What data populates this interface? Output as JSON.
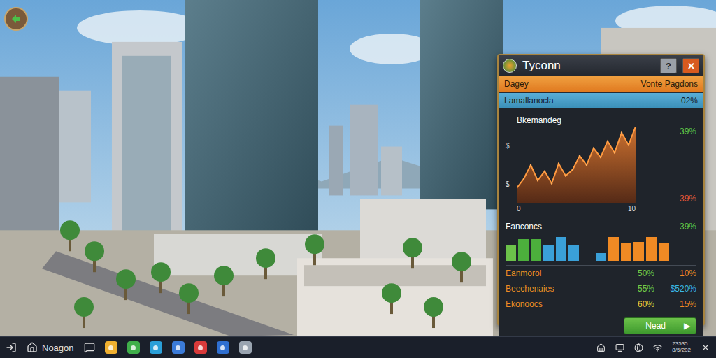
{
  "window": {
    "title": "Tyconn"
  },
  "title_buttons": [
    {
      "label": "?",
      "kind": "help"
    },
    {
      "label": "✕",
      "kind": "close"
    }
  ],
  "header": {
    "left": "Dagey",
    "right": "Vonte Pagdons"
  },
  "highlight_row": {
    "label": "Lamallanocla",
    "value": "02%"
  },
  "line_chart": {
    "title": "Bkemandeg",
    "y_ticks": [
      "$",
      "$"
    ],
    "x_ticks": [
      "0",
      "10"
    ],
    "y_max": 10,
    "values": [
      2,
      3.2,
      5,
      3,
      4.2,
      2.6,
      5.2,
      3.6,
      4.4,
      6.2,
      5,
      7.2,
      6,
      8.1,
      6.6,
      9.2,
      7.6,
      10
    ],
    "readings": [
      {
        "text": "39%",
        "color": "#5fd04a"
      },
      {
        "text": "39%",
        "color": "#e85a3a"
      }
    ]
  },
  "bar_chart": {
    "title": "Fanconcs",
    "value": "39%",
    "groups": [
      [
        {
          "value": 60,
          "color": "#6cc24a"
        },
        {
          "value": 85,
          "color": "#4caf3c"
        },
        {
          "value": 85,
          "color": "#4caf3c"
        },
        {
          "value": 60,
          "color": "#3aa0d8"
        },
        {
          "value": 95,
          "color": "#3aa0d8"
        },
        {
          "value": 60,
          "color": "#3aa0d8"
        }
      ],
      [
        {
          "value": 30,
          "color": "#3aa0d8"
        },
        {
          "value": 95,
          "color": "#f08a24"
        },
        {
          "value": 70,
          "color": "#f08a24"
        },
        {
          "value": 75,
          "color": "#f08a24"
        },
        {
          "value": 95,
          "color": "#f08a24"
        },
        {
          "value": 70,
          "color": "#f08a24"
        }
      ]
    ]
  },
  "stats": [
    {
      "label": "Eanmorol",
      "values": [
        {
          "text": "50%",
          "color": "#6fd04a"
        },
        {
          "text": "10%",
          "color": "#f08a24"
        }
      ]
    },
    {
      "label": "Beechenaies",
      "values": [
        {
          "text": "55%",
          "color": "#6fd04a"
        },
        {
          "text": "$520%",
          "color": "#3ab8e8"
        }
      ]
    },
    {
      "label": "Ekonoocs",
      "values": [
        {
          "text": "60%",
          "color": "#e8d23a"
        },
        {
          "text": "15%",
          "color": "#f08a24"
        }
      ]
    }
  ],
  "next_button": {
    "label": "Nead",
    "icon": "▶"
  },
  "taskbar": {
    "search_label": "Noagon",
    "apps": [
      {
        "color": "#f0b030"
      },
      {
        "color": "#3fae4a"
      },
      {
        "color": "#2a9fd8"
      },
      {
        "color": "#3b7bd8"
      },
      {
        "color": "#d83a3a"
      },
      {
        "color": "#2f6fd0"
      },
      {
        "color": "#9aa4b0"
      }
    ],
    "clock": [
      "23535",
      "8/5/202"
    ]
  }
}
